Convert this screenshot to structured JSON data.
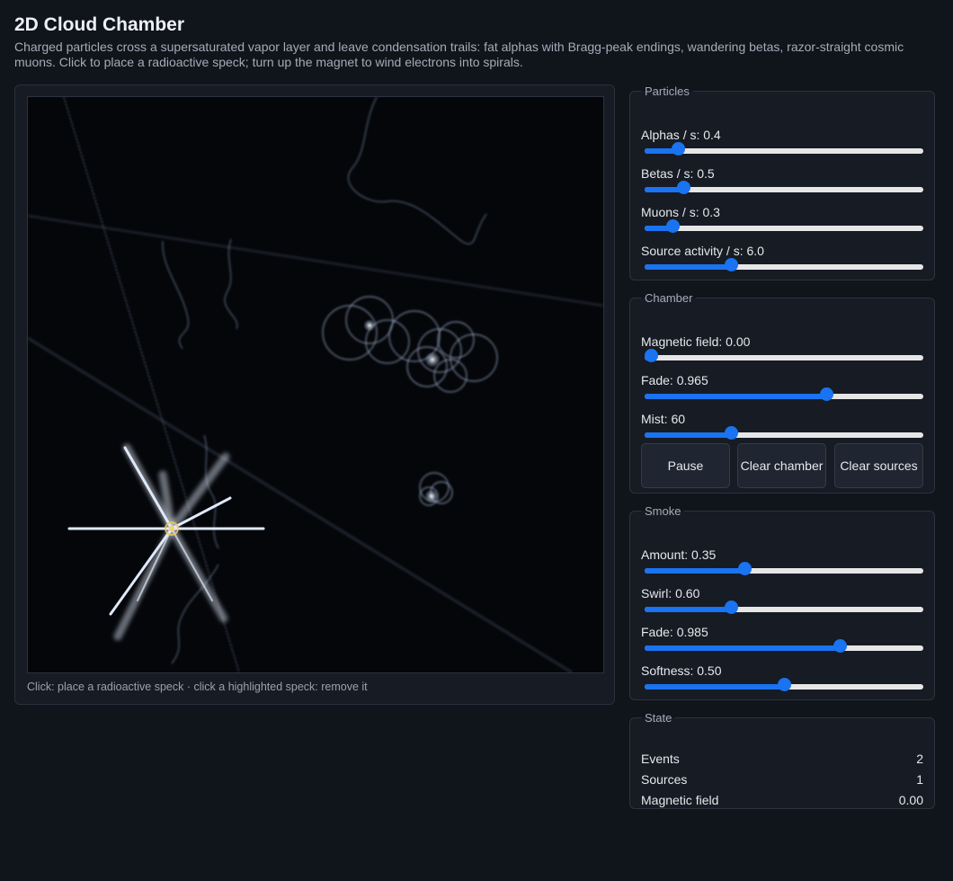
{
  "header": {
    "title": "2D Cloud Chamber",
    "subtitle": "Charged particles cross a supersaturated vapor layer and leave condensation trails: fat alphas with Bragg-peak endings, wandering betas, razor-straight cosmic muons. Click to place a radioactive speck; turn up the magnet to wind electrons into spirals."
  },
  "chamber": {
    "hint": "Click: place a radioactive speck · click a highlighted speck: remove it"
  },
  "particles": {
    "legend": "Particles",
    "alphas": {
      "label": "Alphas / s: 0.4",
      "fraction": 0.1
    },
    "betas": {
      "label": "Betas / s: 0.5",
      "fraction": 0.12
    },
    "muons": {
      "label": "Muons / s: 0.3",
      "fraction": 0.08
    },
    "source": {
      "label": "Source activity / s: 6.0",
      "fraction": 0.3
    }
  },
  "chamber_controls": {
    "legend": "Chamber",
    "magnetic": {
      "label": "Magnetic field: 0.00",
      "fraction": 0.0
    },
    "fade": {
      "label": "Fade: 0.965",
      "fraction": 0.66
    },
    "mist": {
      "label": "Mist: 60",
      "fraction": 0.3
    },
    "pause_label": "Pause",
    "clear_chamber_label": "Clear chamber",
    "clear_sources_label": "Clear sources"
  },
  "smoke": {
    "legend": "Smoke",
    "amount": {
      "label": "Amount: 0.35",
      "fraction": 0.35
    },
    "swirl": {
      "label": "Swirl: 0.60",
      "fraction": 0.3
    },
    "fade": {
      "label": "Fade: 0.985",
      "fraction": 0.71
    },
    "softness": {
      "label": "Softness: 0.50",
      "fraction": 0.5
    }
  },
  "state": {
    "legend": "State",
    "rows": [
      {
        "label": "Events",
        "value": "2"
      },
      {
        "label": "Sources",
        "value": "1"
      },
      {
        "label": "Magnetic field",
        "value": "0.00"
      }
    ]
  },
  "colors": {
    "accent": "#1a73f0",
    "background": "#10141b",
    "panel": "#161b24"
  }
}
